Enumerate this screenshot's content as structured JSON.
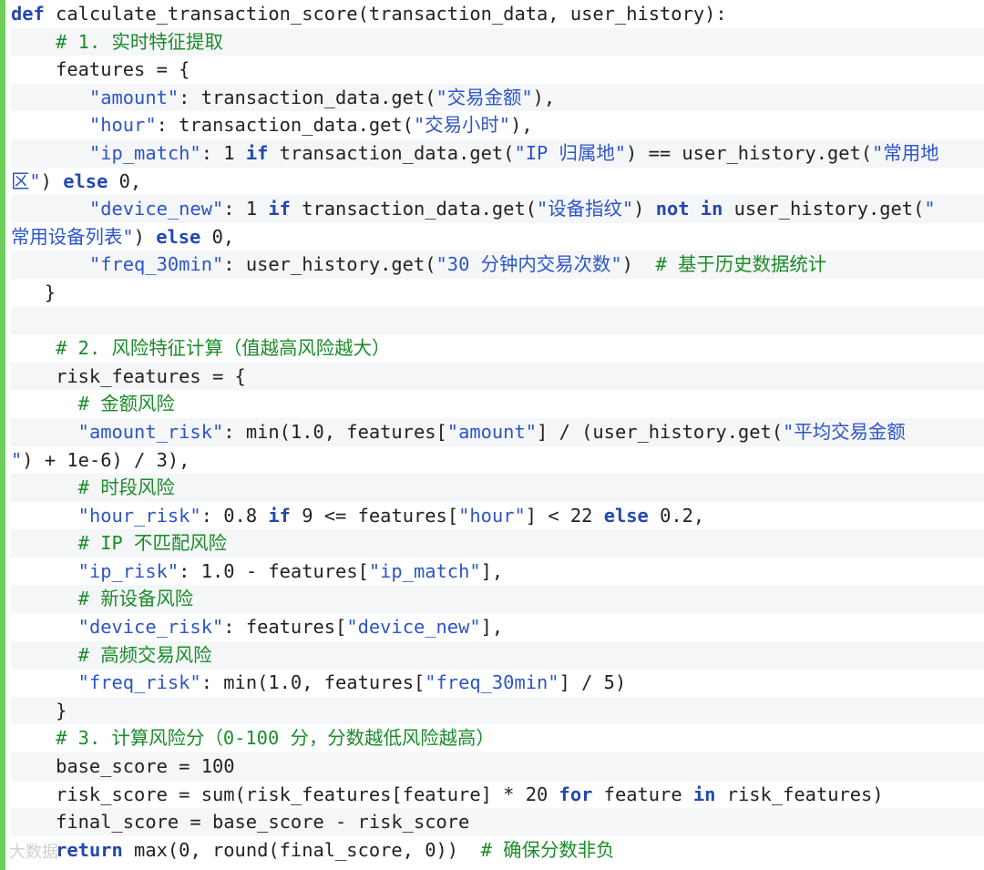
{
  "code_lines": [
    [
      [
        "kw",
        "def"
      ],
      [
        "t",
        " calculate_transaction_score(transaction_data, user_history):"
      ]
    ],
    [
      [
        "t",
        "    "
      ],
      [
        "cmt",
        "# 1. 实时特征提取"
      ]
    ],
    [
      [
        "t",
        "    features = {"
      ]
    ],
    [
      [
        "t",
        "       "
      ],
      [
        "str",
        "\"amount\""
      ],
      [
        "t",
        ": transaction_data.get("
      ],
      [
        "str",
        "\"交易金额\""
      ],
      [
        "t",
        "),"
      ]
    ],
    [
      [
        "t",
        "       "
      ],
      [
        "str",
        "\"hour\""
      ],
      [
        "t",
        ": transaction_data.get("
      ],
      [
        "str",
        "\"交易小时\""
      ],
      [
        "t",
        "),"
      ]
    ],
    [
      [
        "t",
        "       "
      ],
      [
        "str",
        "\"ip_match\""
      ],
      [
        "t",
        ": 1 "
      ],
      [
        "kw",
        "if"
      ],
      [
        "t",
        " transaction_data.get("
      ],
      [
        "str",
        "\"IP 归属地\""
      ],
      [
        "t",
        ") == user_history.get("
      ],
      [
        "str",
        "\"常用地"
      ]
    ],
    [
      [
        "str",
        "区\""
      ],
      [
        "t",
        ") "
      ],
      [
        "kw",
        "else"
      ],
      [
        "t",
        " 0,"
      ]
    ],
    [
      [
        "t",
        "       "
      ],
      [
        "str",
        "\"device_new\""
      ],
      [
        "t",
        ": 1 "
      ],
      [
        "kw",
        "if"
      ],
      [
        "t",
        " transaction_data.get("
      ],
      [
        "str",
        "\"设备指纹\""
      ],
      [
        "t",
        ") "
      ],
      [
        "kw",
        "not in"
      ],
      [
        "t",
        " user_history.get("
      ],
      [
        "str",
        "\""
      ]
    ],
    [
      [
        "str",
        "常用设备列表\""
      ],
      [
        "t",
        ") "
      ],
      [
        "kw",
        "else"
      ],
      [
        "t",
        " 0,"
      ]
    ],
    [
      [
        "t",
        "       "
      ],
      [
        "str",
        "\"freq_30min\""
      ],
      [
        "t",
        ": user_history.get("
      ],
      [
        "str",
        "\"30 分钟内交易次数\""
      ],
      [
        "t",
        ")  "
      ],
      [
        "cmt",
        "# 基于历史数据统计"
      ]
    ],
    [
      [
        "t",
        "   }"
      ]
    ],
    [
      [
        "t",
        ""
      ]
    ],
    [
      [
        "t",
        "    "
      ],
      [
        "cmt",
        "# 2. 风险特征计算（值越高风险越大）"
      ]
    ],
    [
      [
        "t",
        "    risk_features = {"
      ]
    ],
    [
      [
        "t",
        "      "
      ],
      [
        "cmt",
        "# 金额风险"
      ]
    ],
    [
      [
        "t",
        "      "
      ],
      [
        "str",
        "\"amount_risk\""
      ],
      [
        "t",
        ": min(1.0, features["
      ],
      [
        "str",
        "\"amount\""
      ],
      [
        "t",
        "] / (user_history.get("
      ],
      [
        "str",
        "\"平均交易金额"
      ]
    ],
    [
      [
        "str",
        "\""
      ],
      [
        "t",
        ") + 1e-6) / 3),"
      ]
    ],
    [
      [
        "t",
        "      "
      ],
      [
        "cmt",
        "# 时段风险"
      ]
    ],
    [
      [
        "t",
        "      "
      ],
      [
        "str",
        "\"hour_risk\""
      ],
      [
        "t",
        ": 0.8 "
      ],
      [
        "kw",
        "if"
      ],
      [
        "t",
        " 9 <= features["
      ],
      [
        "str",
        "\"hour\""
      ],
      [
        "t",
        "] < 22 "
      ],
      [
        "kw",
        "else"
      ],
      [
        "t",
        " 0.2,"
      ]
    ],
    [
      [
        "t",
        "      "
      ],
      [
        "cmt",
        "# IP 不匹配风险"
      ]
    ],
    [
      [
        "t",
        "      "
      ],
      [
        "str",
        "\"ip_risk\""
      ],
      [
        "t",
        ": 1.0 - features["
      ],
      [
        "str",
        "\"ip_match\""
      ],
      [
        "t",
        "],"
      ]
    ],
    [
      [
        "t",
        "      "
      ],
      [
        "cmt",
        "# 新设备风险"
      ]
    ],
    [
      [
        "t",
        "      "
      ],
      [
        "str",
        "\"device_risk\""
      ],
      [
        "t",
        ": features["
      ],
      [
        "str",
        "\"device_new\""
      ],
      [
        "t",
        "],"
      ]
    ],
    [
      [
        "t",
        "      "
      ],
      [
        "cmt",
        "# 高频交易风险"
      ]
    ],
    [
      [
        "t",
        "      "
      ],
      [
        "str",
        "\"freq_risk\""
      ],
      [
        "t",
        ": min(1.0, features["
      ],
      [
        "str",
        "\"freq_30min\""
      ],
      [
        "t",
        "] / 5)"
      ]
    ],
    [
      [
        "t",
        "    }"
      ]
    ],
    [
      [
        "t",
        "    "
      ],
      [
        "cmt",
        "# 3. 计算风险分（0-100 分，分数越低风险越高）"
      ]
    ],
    [
      [
        "t",
        "    base_score = 100"
      ]
    ],
    [
      [
        "t",
        "    risk_score = sum(risk_features[feature] * 20 "
      ],
      [
        "kw",
        "for"
      ],
      [
        "t",
        " feature "
      ],
      [
        "kw",
        "in"
      ],
      [
        "t",
        " risk_features)"
      ]
    ],
    [
      [
        "t",
        "    final_score = base_score - risk_score"
      ]
    ],
    [
      [
        "t",
        "    "
      ],
      [
        "kw",
        "return"
      ],
      [
        "t",
        " max(0, round(final_score, 0))  "
      ],
      [
        "cmt",
        "# 确保分数非负"
      ]
    ]
  ],
  "watermark": "大数据"
}
